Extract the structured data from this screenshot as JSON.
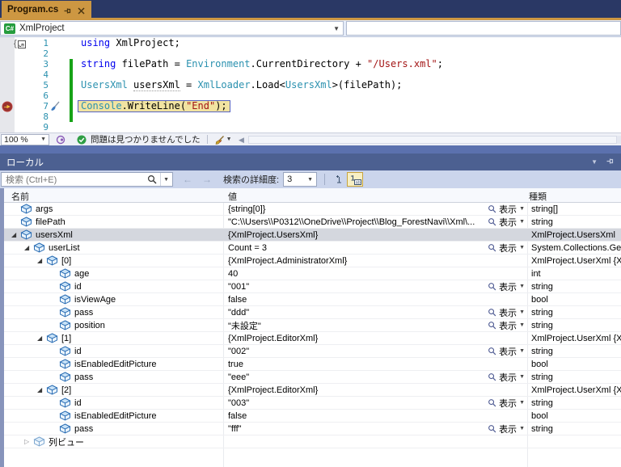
{
  "tab": {
    "title": "Program.cs"
  },
  "navbar": {
    "project": "XmlProject"
  },
  "editor": {
    "current_line": 7,
    "breakpoint_line": 7,
    "lines": [
      {
        "n": 1,
        "segs": [
          {
            "t": "using",
            "c": "kw"
          },
          {
            "t": " XmlProject;",
            "c": "pl"
          }
        ]
      },
      {
        "n": 2,
        "segs": []
      },
      {
        "n": 3,
        "segs": [
          {
            "t": "string",
            "c": "kw"
          },
          {
            "t": " filePath = ",
            "c": "pl"
          },
          {
            "t": "Environment",
            "c": "ty"
          },
          {
            "t": ".CurrentDirectory + ",
            "c": "pl"
          },
          {
            "t": "\"/Users.xml\"",
            "c": "str"
          },
          {
            "t": ";",
            "c": "pl"
          }
        ]
      },
      {
        "n": 4,
        "segs": []
      },
      {
        "n": 5,
        "segs": [
          {
            "t": "UsersXml",
            "c": "ty"
          },
          {
            "t": " ",
            "c": "pl"
          },
          {
            "t": "usersXml",
            "c": "pl sug"
          },
          {
            "t": " = ",
            "c": "pl"
          },
          {
            "t": "XmlLoader",
            "c": "ty"
          },
          {
            "t": ".Load<",
            "c": "pl"
          },
          {
            "t": "UsersXml",
            "c": "ty"
          },
          {
            "t": ">(filePath);",
            "c": "pl"
          }
        ]
      },
      {
        "n": 6,
        "segs": []
      },
      {
        "n": 7,
        "segs": [
          {
            "t": "Console",
            "c": "ty"
          },
          {
            "t": ".WriteLine(",
            "c": "pl"
          },
          {
            "t": "\"End\"",
            "c": "str"
          },
          {
            "t": ");",
            "c": "pl"
          }
        ]
      },
      {
        "n": 8,
        "segs": []
      },
      {
        "n": 9,
        "segs": []
      }
    ]
  },
  "editor_status": {
    "zoom_value": "100 %",
    "health_text": "問題は見つかりませんでした"
  },
  "locals": {
    "title": "ローカル",
    "search_placeholder": "検索 (Ctrl+E)",
    "back_arrow": "←",
    "forward_arrow": "→",
    "depth_label": "検索の詳細度:",
    "depth_value": "3",
    "view_label": "表示",
    "columns": [
      "名前",
      "値",
      "種類"
    ],
    "rows": [
      {
        "level": 0,
        "expand": "",
        "name": "args",
        "value": "{string[0]}",
        "view": true,
        "type": "string[]"
      },
      {
        "level": 0,
        "expand": "",
        "name": "filePath",
        "value": "\"C:\\\\Users\\\\P0312\\\\OneDrive\\\\Project\\\\Blog_ForestNavi\\\\Xml\\...",
        "view": true,
        "type": "string"
      },
      {
        "level": 0,
        "expand": "open",
        "name": "usersXml",
        "value": "{XmlProject.UsersXml}",
        "view": false,
        "type": "XmlProject.UsersXml",
        "selected": true
      },
      {
        "level": 1,
        "expand": "open",
        "name": "userList",
        "value": "Count = 3",
        "view": true,
        "type": "System.Collections.Ge"
      },
      {
        "level": 2,
        "expand": "open",
        "name": "[0]",
        "value": "{XmlProject.AdministratorXml}",
        "view": false,
        "type": "XmlProject.UserXml {X"
      },
      {
        "level": 3,
        "expand": "",
        "name": "age",
        "value": "40",
        "view": false,
        "type": "int"
      },
      {
        "level": 3,
        "expand": "",
        "name": "id",
        "value": "\"001\"",
        "view": true,
        "type": "string"
      },
      {
        "level": 3,
        "expand": "",
        "name": "isViewAge",
        "value": "false",
        "view": false,
        "type": "bool"
      },
      {
        "level": 3,
        "expand": "",
        "name": "pass",
        "value": "\"ddd\"",
        "view": true,
        "type": "string"
      },
      {
        "level": 3,
        "expand": "",
        "name": "position",
        "value": "\"未設定\"",
        "view": true,
        "type": "string"
      },
      {
        "level": 2,
        "expand": "open",
        "name": "[1]",
        "value": "{XmlProject.EditorXml}",
        "view": false,
        "type": "XmlProject.UserXml {X"
      },
      {
        "level": 3,
        "expand": "",
        "name": "id",
        "value": "\"002\"",
        "view": true,
        "type": "string"
      },
      {
        "level": 3,
        "expand": "",
        "name": "isEnabledEditPicture",
        "value": "true",
        "view": false,
        "type": "bool"
      },
      {
        "level": 3,
        "expand": "",
        "name": "pass",
        "value": "\"eee\"",
        "view": true,
        "type": "string"
      },
      {
        "level": 2,
        "expand": "open",
        "name": "[2]",
        "value": "{XmlProject.EditorXml}",
        "view": false,
        "type": "XmlProject.UserXml {X"
      },
      {
        "level": 3,
        "expand": "",
        "name": "id",
        "value": "\"003\"",
        "view": true,
        "type": "string"
      },
      {
        "level": 3,
        "expand": "",
        "name": "isEnabledEditPicture",
        "value": "false",
        "view": false,
        "type": "bool"
      },
      {
        "level": 3,
        "expand": "",
        "name": "pass",
        "value": "\"fff\"",
        "view": true,
        "type": "string"
      },
      {
        "level": 1,
        "expand": "closed",
        "name": "列ビュー",
        "value": "",
        "view": false,
        "type": "",
        "icon": "light"
      }
    ]
  },
  "colors": {
    "accent_gold": "#CD9742",
    "navy": "#2A3865",
    "title_blue": "#4C6091",
    "keyword": "#0000EE",
    "type": "#2B91AF",
    "string": "#A31515",
    "change_bar_green": "#17A317"
  }
}
